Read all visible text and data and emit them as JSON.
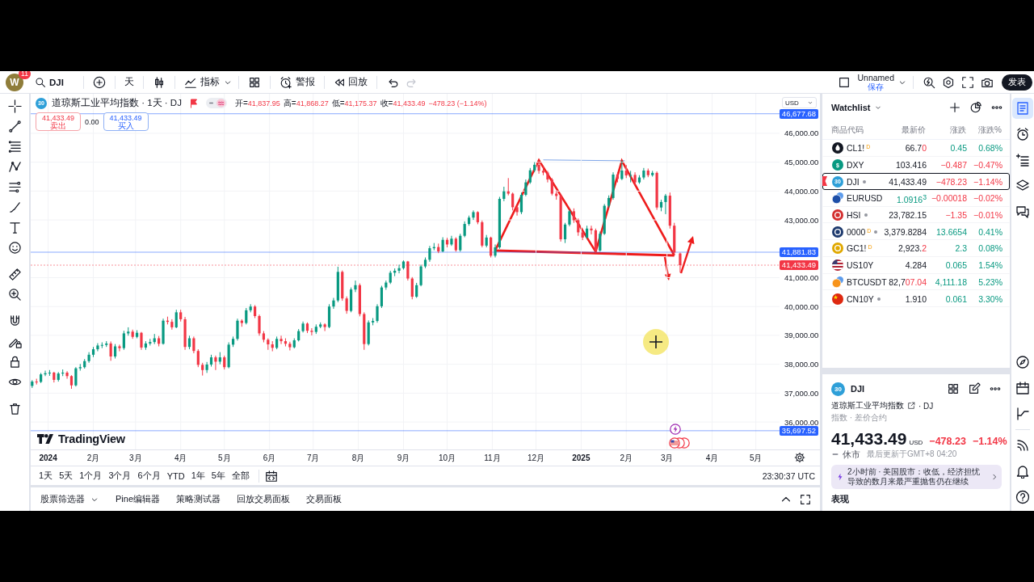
{
  "topbar": {
    "avatar": "W",
    "notifications": "11",
    "symbol": "DJI",
    "interval": "天",
    "indicators": "指标",
    "alert": "警报",
    "replay": "回放",
    "undo": {
      "disabled": false
    },
    "redo": {
      "disabled": true
    },
    "layout_name": "Unnamed",
    "layout_save": "保存",
    "publish": "发表"
  },
  "chart": {
    "badge": "30",
    "title": "道琼斯工业平均指数 · 1天 · DJ",
    "legend": [
      {
        "label": "开=",
        "value": "41,837.95"
      },
      {
        "label": "高=",
        "value": "41,868.27"
      },
      {
        "label": "低=",
        "value": "41,175.37"
      },
      {
        "label": "收=",
        "value": "41,433.49"
      }
    ],
    "change": "−478.23 (−1.14%)",
    "falling": true,
    "sell": {
      "price": "41,433.49",
      "label": "卖出"
    },
    "spread": "0.00",
    "buy": {
      "price": "41,433.49",
      "label": "买入"
    },
    "currency": "USD",
    "logo": "TradingView",
    "chart_data": [
      {
        "type": "candlestick",
        "x": [
          "2023-12-21",
          "2023-12-24",
          "2023-12-27",
          "2023-12-30",
          "2024-01-02",
          "2024-01-05",
          "2024-01-08",
          "2024-01-11",
          "2024-01-14",
          "2024-01-17",
          "2024-01-20",
          "2024-01-23",
          "2024-01-26",
          "2024-01-29",
          "2024-02-01",
          "2024-02-04",
          "2024-02-07",
          "2024-02-10",
          "2024-02-13",
          "2024-02-16",
          "2024-02-19",
          "2024-02-22",
          "2024-02-25",
          "2024-02-28",
          "2024-03-02",
          "2024-03-05",
          "2024-03-08",
          "2024-03-11",
          "2024-03-14",
          "2024-03-17",
          "2024-03-20",
          "2024-03-23",
          "2024-03-26",
          "2024-03-29",
          "2024-04-01",
          "2024-04-04",
          "2024-04-07",
          "2024-04-10",
          "2024-04-13",
          "2024-04-16",
          "2024-04-19",
          "2024-04-22",
          "2024-04-25",
          "2024-04-28",
          "2024-05-01",
          "2024-05-04",
          "2024-05-07",
          "2024-05-10",
          "2024-05-13",
          "2024-05-16",
          "2024-05-19",
          "2024-05-22",
          "2024-05-25",
          "2024-05-28",
          "2024-05-31",
          "2024-06-03",
          "2024-06-06",
          "2024-06-09",
          "2024-06-12",
          "2024-06-15",
          "2024-06-18",
          "2024-06-21",
          "2024-06-24",
          "2024-06-27",
          "2024-06-30",
          "2024-07-03",
          "2024-07-06",
          "2024-07-09",
          "2024-07-12",
          "2024-07-15",
          "2024-07-18",
          "2024-07-21",
          "2024-07-24",
          "2024-07-27",
          "2024-07-30",
          "2024-08-02",
          "2024-08-05",
          "2024-08-08",
          "2024-08-11",
          "2024-08-14",
          "2024-08-17",
          "2024-08-20",
          "2024-08-23",
          "2024-08-26",
          "2024-08-29",
          "2024-09-01",
          "2024-09-04",
          "2024-09-07",
          "2024-09-10",
          "2024-09-13",
          "2024-09-16",
          "2024-09-19",
          "2024-09-22",
          "2024-09-25",
          "2024-09-28",
          "2024-10-01",
          "2024-10-04",
          "2024-10-07",
          "2024-10-10",
          "2024-10-13",
          "2024-10-16",
          "2024-10-19",
          "2024-10-22",
          "2024-10-25",
          "2024-10-28",
          "2024-10-31",
          "2024-11-03",
          "2024-11-06",
          "2024-11-09",
          "2024-11-12",
          "2024-11-15",
          "2024-11-18",
          "2024-11-21",
          "2024-11-24",
          "2024-11-27",
          "2024-11-30",
          "2024-12-03",
          "2024-12-06",
          "2024-12-09",
          "2024-12-12",
          "2024-12-15",
          "2024-12-18",
          "2024-12-21",
          "2024-12-24",
          "2024-12-27",
          "2024-12-30",
          "2025-01-02",
          "2025-01-05",
          "2025-01-08",
          "2025-01-11",
          "2025-01-14",
          "2025-01-17",
          "2025-01-20",
          "2025-01-23",
          "2025-01-26",
          "2025-01-29",
          "2025-02-01",
          "2025-02-04",
          "2025-02-07",
          "2025-02-10",
          "2025-02-13",
          "2025-02-16",
          "2025-02-19",
          "2025-02-22",
          "2025-02-25",
          "2025-02-28",
          "2025-03-03",
          "2025-03-06",
          "2025-03-10"
        ],
        "ohlc": [
          [
            37250,
            37450,
            37180,
            37400
          ],
          [
            37400,
            37500,
            37300,
            37390
          ],
          [
            37390,
            37700,
            37350,
            37650
          ],
          [
            37650,
            37780,
            37590,
            37690
          ],
          [
            37690,
            37800,
            37600,
            37710
          ],
          [
            37710,
            37740,
            37370,
            37460
          ],
          [
            37460,
            37730,
            37400,
            37680
          ],
          [
            37680,
            37820,
            37590,
            37710
          ],
          [
            37710,
            37760,
            37500,
            37590
          ],
          [
            37590,
            37620,
            37150,
            37270
          ],
          [
            37270,
            37900,
            37230,
            37860
          ],
          [
            37860,
            38010,
            37780,
            37900
          ],
          [
            37900,
            38180,
            37850,
            38110
          ],
          [
            38110,
            38420,
            38050,
            38330
          ],
          [
            38330,
            38600,
            38250,
            38520
          ],
          [
            38520,
            38730,
            38450,
            38650
          ],
          [
            38650,
            38760,
            38560,
            38670
          ],
          [
            38670,
            38800,
            38600,
            38720
          ],
          [
            38720,
            38790,
            38120,
            38270
          ],
          [
            38270,
            38700,
            38200,
            38620
          ],
          [
            38620,
            38680,
            38450,
            38560
          ],
          [
            38560,
            39160,
            38500,
            39070
          ],
          [
            39070,
            39280,
            38990,
            39130
          ],
          [
            39130,
            39200,
            38880,
            38950
          ],
          [
            38950,
            39180,
            38900,
            39090
          ],
          [
            39090,
            39120,
            38500,
            38580
          ],
          [
            38580,
            38800,
            38500,
            38720
          ],
          [
            38720,
            38880,
            38650,
            38770
          ],
          [
            38770,
            39050,
            38700,
            38900
          ],
          [
            38900,
            38980,
            38620,
            38710
          ],
          [
            38710,
            39580,
            38680,
            39510
          ],
          [
            39510,
            39650,
            39380,
            39470
          ],
          [
            39470,
            39560,
            39200,
            39280
          ],
          [
            39280,
            39890,
            39250,
            39800
          ],
          [
            39800,
            39890,
            39480,
            39560
          ],
          [
            39560,
            39640,
            38500,
            38600
          ],
          [
            38600,
            38990,
            38520,
            38900
          ],
          [
            38900,
            38960,
            38380,
            38460
          ],
          [
            38460,
            38520,
            37900,
            37980
          ],
          [
            37980,
            38050,
            37610,
            37800
          ],
          [
            37800,
            38080,
            37700,
            37990
          ],
          [
            37990,
            38330,
            37920,
            38240
          ],
          [
            38240,
            38300,
            37800,
            38090
          ],
          [
            38090,
            38420,
            38000,
            38240
          ],
          [
            38240,
            38300,
            37820,
            37900
          ],
          [
            37900,
            38760,
            37860,
            38680
          ],
          [
            38680,
            38960,
            38600,
            38880
          ],
          [
            38880,
            39580,
            38820,
            39510
          ],
          [
            39510,
            39560,
            39300,
            39430
          ],
          [
            39430,
            39950,
            39380,
            39870
          ],
          [
            39870,
            40080,
            39800,
            40000
          ],
          [
            40000,
            40050,
            39600,
            39670
          ],
          [
            39670,
            39720,
            38990,
            39070
          ],
          [
            39070,
            39150,
            38760,
            38850
          ],
          [
            38850,
            38900,
            38500,
            38690
          ],
          [
            38690,
            38800,
            38450,
            38570
          ],
          [
            38570,
            38960,
            38520,
            38880
          ],
          [
            38880,
            38990,
            38700,
            38800
          ],
          [
            38800,
            38900,
            38620,
            38710
          ],
          [
            38710,
            38780,
            38480,
            38590
          ],
          [
            38590,
            38900,
            38550,
            38830
          ],
          [
            38830,
            39220,
            38790,
            39150
          ],
          [
            39150,
            39480,
            39100,
            39410
          ],
          [
            39410,
            39450,
            39080,
            39160
          ],
          [
            39160,
            39250,
            39000,
            39120
          ],
          [
            39120,
            39380,
            39050,
            39300
          ],
          [
            39300,
            39450,
            39250,
            39380
          ],
          [
            39380,
            39420,
            39150,
            39290
          ],
          [
            39290,
            40080,
            39250,
            40000
          ],
          [
            40000,
            40300,
            39920,
            40210
          ],
          [
            40210,
            41380,
            40150,
            41200
          ],
          [
            41200,
            41250,
            40200,
            40280
          ],
          [
            40280,
            40350,
            39750,
            39850
          ],
          [
            39850,
            40660,
            39800,
            40590
          ],
          [
            40590,
            40900,
            40500,
            40740
          ],
          [
            40740,
            40800,
            39660,
            39740
          ],
          [
            39740,
            39800,
            38500,
            38700
          ],
          [
            38700,
            39520,
            38650,
            39450
          ],
          [
            39450,
            39600,
            39350,
            39500
          ],
          [
            39500,
            40080,
            39440,
            40010
          ],
          [
            40010,
            40720,
            39950,
            40660
          ],
          [
            40660,
            40900,
            40580,
            40830
          ],
          [
            40830,
            41240,
            40780,
            41170
          ],
          [
            41170,
            41320,
            41050,
            41240
          ],
          [
            41240,
            41450,
            41150,
            41330
          ],
          [
            41330,
            41600,
            41280,
            41560
          ],
          [
            41560,
            41580,
            40900,
            40970
          ],
          [
            40970,
            41020,
            40250,
            40340
          ],
          [
            40340,
            40820,
            40300,
            40740
          ],
          [
            40740,
            41450,
            40700,
            41390
          ],
          [
            41390,
            41700,
            41330,
            41620
          ],
          [
            41620,
            42100,
            41550,
            42020
          ],
          [
            42020,
            42200,
            41950,
            42060
          ],
          [
            42060,
            42180,
            41850,
            41910
          ],
          [
            41910,
            42400,
            41880,
            42310
          ],
          [
            42310,
            42380,
            42050,
            42150
          ],
          [
            42150,
            42450,
            42100,
            42350
          ],
          [
            42350,
            42400,
            41900,
            41950
          ],
          [
            41950,
            42520,
            41900,
            42450
          ],
          [
            42450,
            42950,
            42400,
            42860
          ],
          [
            42860,
            43150,
            42800,
            43080
          ],
          [
            43080,
            43330,
            43000,
            43270
          ],
          [
            43270,
            43300,
            42850,
            42920
          ],
          [
            42920,
            42980,
            42050,
            42110
          ],
          [
            42110,
            42480,
            42050,
            42390
          ],
          [
            42390,
            42420,
            41700,
            41760
          ],
          [
            41760,
            42150,
            41700,
            42050
          ],
          [
            42050,
            43800,
            42000,
            43730
          ],
          [
            43730,
            44150,
            43650,
            43990
          ],
          [
            43990,
            44450,
            43850,
            43910
          ],
          [
            43910,
            43950,
            43330,
            43440
          ],
          [
            43440,
            43500,
            43150,
            43270
          ],
          [
            43270,
            43950,
            43200,
            43870
          ],
          [
            43870,
            44400,
            43820,
            44300
          ],
          [
            44300,
            44800,
            44250,
            44720
          ],
          [
            44720,
            45000,
            44650,
            44910
          ],
          [
            44910,
            45070,
            44600,
            44700
          ],
          [
            44700,
            44850,
            44550,
            44640
          ],
          [
            44640,
            44700,
            44300,
            44400
          ],
          [
            44400,
            44450,
            43850,
            43910
          ],
          [
            43910,
            44000,
            43700,
            43830
          ],
          [
            43830,
            43900,
            42250,
            42330
          ],
          [
            42330,
            42900,
            42200,
            42840
          ],
          [
            42840,
            43350,
            42780,
            43300
          ],
          [
            43300,
            43400,
            42900,
            42990
          ],
          [
            42990,
            43050,
            42450,
            42570
          ],
          [
            42570,
            42700,
            42300,
            42390
          ],
          [
            42390,
            42800,
            42350,
            42700
          ],
          [
            42700,
            42800,
            42500,
            42640
          ],
          [
            42640,
            42700,
            41850,
            41940
          ],
          [
            41940,
            42600,
            41900,
            42520
          ],
          [
            42520,
            43550,
            42480,
            43490
          ],
          [
            43490,
            43850,
            43420,
            43760
          ],
          [
            43760,
            44650,
            43700,
            44570
          ],
          [
            44570,
            44650,
            44300,
            44420
          ],
          [
            44420,
            45050,
            44380,
            44710
          ],
          [
            44710,
            44900,
            44450,
            44540
          ],
          [
            44540,
            44700,
            44300,
            44560
          ],
          [
            44560,
            44650,
            44200,
            44300
          ],
          [
            44300,
            44550,
            44250,
            44470
          ],
          [
            44470,
            44800,
            44400,
            44710
          ],
          [
            44710,
            44780,
            44480,
            44550
          ],
          [
            44550,
            44700,
            44500,
            44630
          ],
          [
            44630,
            44680,
            43350,
            43430
          ],
          [
            43430,
            43700,
            43300,
            43620
          ],
          [
            43620,
            43900,
            43200,
            43840
          ],
          [
            43840,
            43950,
            42700,
            42800
          ],
          [
            42800,
            42900,
            41780,
            41870
          ],
          [
            41837.95,
            41868.27,
            41175.37,
            41433.49
          ]
        ],
        "xlim": [
          "2023-12-20",
          "2025-06-14"
        ],
        "ylim": [
          35050,
          47370
        ],
        "grid": true,
        "xticks": [
          {
            "value": "2024-01-01",
            "label": "2024"
          },
          {
            "value": "2024-02-01",
            "label": "2月"
          },
          {
            "value": "2024-03-01",
            "label": "3月"
          },
          {
            "value": "2024-04-01",
            "label": "4月"
          },
          {
            "value": "2024-05-01",
            "label": "5月"
          },
          {
            "value": "2024-06-01",
            "label": "6月"
          },
          {
            "value": "2024-07-01",
            "label": "7月"
          },
          {
            "value": "2024-08-01",
            "label": "8月"
          },
          {
            "value": "2024-09-01",
            "label": "9月"
          },
          {
            "value": "2024-10-01",
            "label": "10月"
          },
          {
            "value": "2024-11-01",
            "label": "11月"
          },
          {
            "value": "2024-12-01",
            "label": "12月"
          },
          {
            "value": "2025-01-01",
            "label": "2025"
          },
          {
            "value": "2025-02-01",
            "label": "2月"
          },
          {
            "value": "2025-03-01",
            "label": "3月"
          },
          {
            "value": "2025-04-01",
            "label": "4月"
          },
          {
            "value": "2025-05-01",
            "label": "5月"
          }
        ],
        "yticks": [
          {
            "value": 46000,
            "label": "46,000.00"
          },
          {
            "value": 45000,
            "label": "45,000.00"
          },
          {
            "value": 44000,
            "label": "44,000.00"
          },
          {
            "value": 43000,
            "label": "43,000.00"
          },
          {
            "value": 41000,
            "label": "41,000.00"
          },
          {
            "value": 40000,
            "label": "40,000.00"
          },
          {
            "value": 39000,
            "label": "39,000.00"
          },
          {
            "value": 38000,
            "label": "38,000.00"
          },
          {
            "value": 37000,
            "label": "37,000.00"
          },
          {
            "value": 36000,
            "label": "36,000.00"
          }
        ],
        "ref_lines": [
          {
            "axis": "y",
            "value": 46677.68,
            "label": "46,677.68",
            "color": "#2962ff"
          },
          {
            "axis": "y",
            "value": 41881.83,
            "label": "41,881.83",
            "color": "#2962ff"
          },
          {
            "axis": "y",
            "value": 41433.49,
            "label": "41,433.49",
            "color": "#f23645",
            "line_style": "dotted"
          },
          {
            "axis": "y",
            "value": 35697.52,
            "label": "35,697.52",
            "color": "#2962ff"
          }
        ]
      }
    ]
  },
  "ranges": [
    "1天",
    "5天",
    "1个月",
    "3个月",
    "6个月",
    "YTD",
    "1年",
    "5年",
    "全部"
  ],
  "clock": "23:30:37 UTC",
  "bottom_tabs": [
    {
      "label": "股票筛选器",
      "menu": true
    },
    {
      "label": "Pine编辑器",
      "menu": false
    },
    {
      "label": "策略测试器",
      "menu": false
    },
    {
      "label": "回放交易面板",
      "menu": false
    },
    {
      "label": "交易面板",
      "menu": false
    }
  ],
  "watchlist": {
    "title": "Watchlist",
    "columns": [
      "商品代码",
      "最新价",
      "涨跌",
      "涨跌%"
    ],
    "rows": [
      {
        "symbol": "CL1!",
        "kind": "drop",
        "color": "#131722",
        "tag": "D",
        "dot": false,
        "last": [
          {
            "text": "66.7",
            "kind": "plain"
          },
          {
            "text": "0",
            "kind": "down"
          }
        ],
        "change": "0.45",
        "change_pct": "0.68%",
        "falling": false,
        "selected": false,
        "flagged": false
      },
      {
        "symbol": "DXY",
        "kind": "text",
        "logo_text": "$",
        "color": "#089981",
        "dot": false,
        "last": [
          {
            "text": "103.416",
            "kind": "plain"
          }
        ],
        "change": "−0.487",
        "change_pct": "−0.47%",
        "falling": true,
        "selected": false,
        "flagged": false
      },
      {
        "symbol": "DJI",
        "kind": "text",
        "logo_text": "30",
        "color": "#2e9fd8",
        "dot": true,
        "last": [
          {
            "text": "41,433.49",
            "kind": "plain"
          }
        ],
        "change": "−478.23",
        "change_pct": "−1.14%",
        "falling": true,
        "selected": true,
        "flagged": true
      },
      {
        "symbol": "EURUSD",
        "kind": "pair",
        "color": "#1e4fa8",
        "dot": false,
        "last": [
          {
            "text": "1.0916$^{3}$",
            "kind": "up"
          }
        ],
        "change": "−0.00018",
        "change_pct": "−0.02%",
        "falling": true,
        "selected": false,
        "flagged": false
      },
      {
        "symbol": "HSI",
        "kind": "disc",
        "color": "#d32f2f",
        "dot": true,
        "last": [
          {
            "text": "23,782.15",
            "kind": "plain"
          }
        ],
        "change": "−1.35",
        "change_pct": "−0.01%",
        "falling": true,
        "selected": false,
        "flagged": false
      },
      {
        "symbol": "0000",
        "kind": "disc",
        "color": "#1e3a6e",
        "tag": "D",
        "dot": true,
        "last": [
          {
            "text": "3,379.8284",
            "kind": "plain"
          }
        ],
        "change": "13.6654",
        "change_pct": "0.41%",
        "falling": false,
        "selected": false,
        "flagged": false
      },
      {
        "symbol": "GC1!",
        "kind": "disc",
        "color": "#e0a800",
        "tag": "D",
        "dot": false,
        "last": [
          {
            "text": "2,923.",
            "kind": "plain"
          },
          {
            "text": "2",
            "kind": "down"
          }
        ],
        "change": "2.3",
        "change_pct": "0.08%",
        "falling": false,
        "selected": false,
        "flagged": false
      },
      {
        "symbol": "US10Y",
        "kind": "flag-us",
        "color": "#b22234",
        "dot": false,
        "last": [
          {
            "text": "4.284",
            "kind": "plain"
          }
        ],
        "change": "0.065",
        "change_pct": "1.54%",
        "falling": false,
        "selected": false,
        "flagged": false
      },
      {
        "symbol": "BTCUSDT",
        "kind": "pair",
        "color": "#f7931a",
        "dot": false,
        "last": [
          {
            "text": "82,7",
            "kind": "plain"
          },
          {
            "text": "07.04",
            "kind": "down"
          }
        ],
        "change": "4,111.18",
        "change_pct": "5.23%",
        "falling": false,
        "selected": false,
        "flagged": false
      },
      {
        "symbol": "CN10Y",
        "kind": "flag-cn",
        "color": "#de2910",
        "dot": true,
        "last": [
          {
            "text": "1.910",
            "kind": "plain"
          }
        ],
        "change": "0.061",
        "change_pct": "3.30%",
        "falling": false,
        "selected": false,
        "flagged": false
      }
    ]
  },
  "details": {
    "badge": "30",
    "symbol": "DJI",
    "name": "道琼斯工业平均指数",
    "exchange": "· DJ",
    "category": "指数 · 差价合约",
    "price": "41,433.49",
    "currency": "USD",
    "change": "−478.23",
    "change_pct": "−1.14%",
    "falling": true,
    "status": "休市",
    "updated": "最后更新于GMT+8 04:20",
    "news": "2小时前 · 美国股市：收低，经济担忧导致的数月来最严重抛售仍在继续",
    "section": "表现"
  },
  "side_panels": [
    {
      "selected": true
    },
    {
      "selected": false
    },
    {
      "selected": false
    },
    {
      "selected": false
    },
    {
      "selected": false
    },
    {
      "selected": false
    },
    {
      "selected": false
    },
    {
      "selected": false
    },
    {
      "selected": false
    },
    {
      "selected": false
    },
    {
      "selected": false
    }
  ]
}
